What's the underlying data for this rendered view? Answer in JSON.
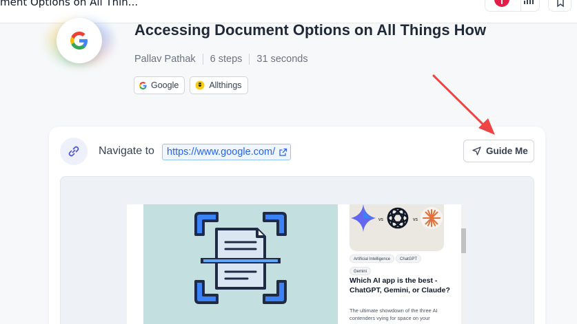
{
  "browser": {
    "tab_title": "ment Options on All Thin..."
  },
  "guide": {
    "title": "Accessing Document Options on All Things How",
    "author": "Pallav Pathak",
    "steps": "6 steps",
    "duration": "31 seconds",
    "tags": [
      {
        "label": "Google",
        "icon": "google-icon"
      },
      {
        "label": "Allthings",
        "icon": "allthings-icon"
      }
    ]
  },
  "step": {
    "action_label": "Navigate to",
    "url": "https://www.google.com/",
    "guide_button": "Guide Me"
  },
  "preview": {
    "chips": [
      "Artificial Intelligence",
      "ChatGPT",
      "Gemini"
    ],
    "article_title": "Which AI app is the best - ChatGPT, Gemini, or Claude?",
    "article_desc": "The ultimate showdown of the three AI contenders vying for space on your"
  },
  "colors": {
    "accent": "#2563eb",
    "annotation_arrow": "#ef4444",
    "hero_bg": "#c3dfe0"
  }
}
